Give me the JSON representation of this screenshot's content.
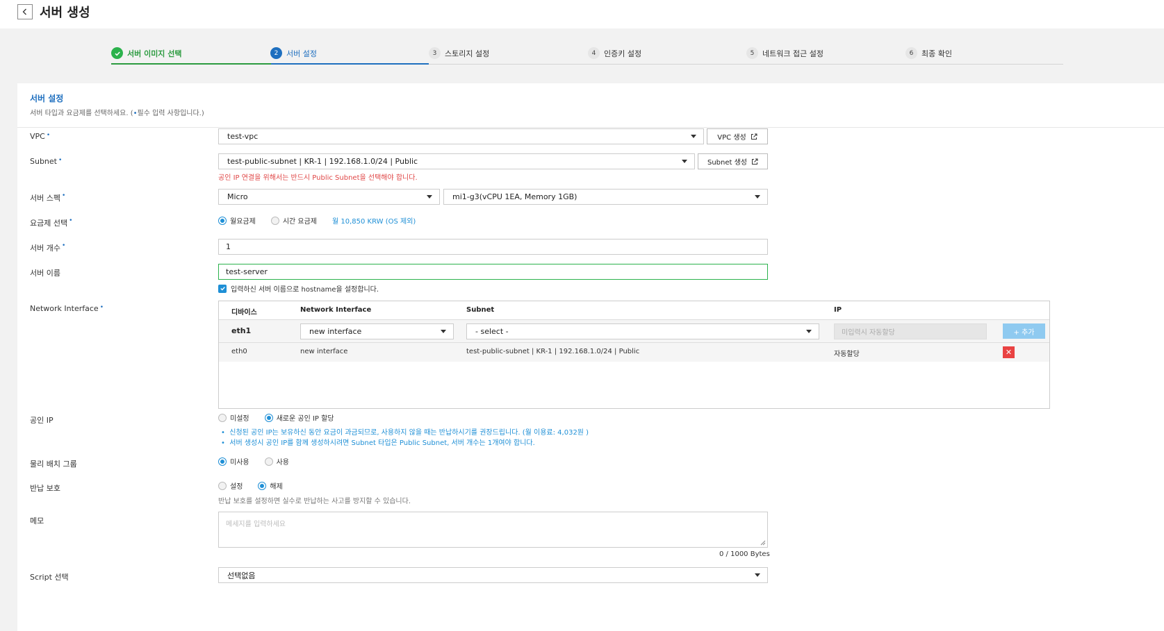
{
  "header": {
    "title": "서버 생성"
  },
  "steps": [
    {
      "num": "",
      "label": "서버 이미지 선택",
      "state": "done"
    },
    {
      "num": "2",
      "label": "서버 설정",
      "state": "current"
    },
    {
      "num": "3",
      "label": "스토리지 설정",
      "state": "todo"
    },
    {
      "num": "4",
      "label": "인증키 설정",
      "state": "todo"
    },
    {
      "num": "5",
      "label": "네트워크 접근 설정",
      "state": "todo"
    },
    {
      "num": "6",
      "label": "최종 확인",
      "state": "todo"
    }
  ],
  "section": {
    "title": "서버 설정",
    "desc_prefix": "서버 타입과 요금제를 선택하세요. (",
    "desc_dot": "•",
    "desc_suffix": "필수 입력 사항입니다.)"
  },
  "required_mark": "•",
  "vpc": {
    "label": "VPC",
    "value": "test-vpc",
    "button": "VPC 생성"
  },
  "subnet": {
    "label": "Subnet",
    "value": "test-public-subnet | KR-1 | 192.168.1.0/24 | Public",
    "button": "Subnet 생성",
    "warning": "공인 IP 연결을 위해서는 반드시 Public Subnet을 선택해야 합니다."
  },
  "spec": {
    "label": "서버 스펙",
    "type": "Micro",
    "detail": "mi1-g3(vCPU 1EA, Memory 1GB)"
  },
  "billing": {
    "label": "요금제 선택",
    "option_monthly": "월요금제",
    "option_hourly": "시간 요금제",
    "price": "월 10,850 KRW (OS 제외)"
  },
  "count": {
    "label": "서버 개수",
    "value": "1"
  },
  "name": {
    "label": "서버 이름",
    "value": "test-server",
    "checkbox_label": "입력하신 서버 이름으로 hostname을 설정합니다."
  },
  "network_interface": {
    "label": "Network Interface",
    "columns": [
      "디바이스",
      "Network Interface",
      "Subnet",
      "IP"
    ],
    "edit_row": {
      "device": "eth1",
      "interface": "new interface",
      "subnet": "- select -",
      "ip_placeholder": "미입력시 자동할당",
      "add_button": "+ 추가"
    },
    "rows": [
      {
        "device": "eth0",
        "interface": "new interface",
        "subnet": "test-public-subnet | KR-1 | 192.168.1.0/24 | Public",
        "ip": "자동할당",
        "delete": "✕"
      }
    ]
  },
  "public_ip": {
    "label": "공인 IP",
    "option_none": "미설정",
    "option_new": "새로운 공인 IP 할당",
    "note1": "신청된 공인 IP는 보유하신 동안 요금이 과금되므로, 사용하지 않을 때는 반납하시기를 권장드립니다. (월 이용료: 4,032원 )",
    "note2": "서버 생성시 공인 IP를 함께 생성하시려면 Subnet 타입은 Public Subnet, 서버 개수는 1개여야 합니다."
  },
  "placement": {
    "label": "물리 배치 그룹",
    "option_off": "미사용",
    "option_on": "사용"
  },
  "protection": {
    "label": "반납 보호",
    "option_on": "설정",
    "option_off": "해제",
    "hint": "반납 보호를 설정하면 실수로 반납하는 사고를 방지할 수 있습니다."
  },
  "memo": {
    "label": "메모",
    "placeholder": "메세지를 입력하세요",
    "counter": "0 / 1000 Bytes"
  },
  "script": {
    "label": "Script 선택",
    "value": "선택없음"
  },
  "colors": {
    "accent_blue": "#1e6fbf",
    "done_green": "#2b9a3f",
    "warning_red": "#e04747",
    "delete_red": "#e94242"
  },
  "icons": [
    "back-arrow-icon",
    "check-icon",
    "external-link-icon",
    "caret-down-icon",
    "resize-handle-icon"
  ]
}
